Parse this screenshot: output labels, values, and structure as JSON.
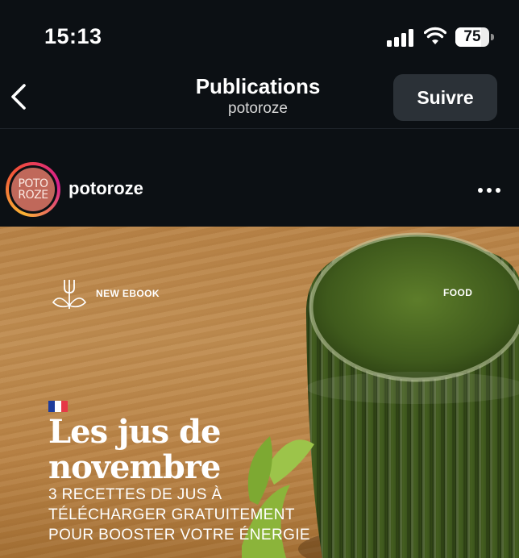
{
  "status_bar": {
    "time": "15:13",
    "battery_percent": "75",
    "battery_level": 0.75
  },
  "header": {
    "title": "Publications",
    "subtitle": "potoroze",
    "follow_label": "Suivre"
  },
  "post": {
    "username": "potoroze",
    "avatar_text": [
      "POTO",
      "ROZE"
    ],
    "image": {
      "ebook_label": "NEW EBOOK",
      "category_label": "FOOD",
      "headline_line1": "Les jus de",
      "headline_line2": "novembre",
      "subhead_line1": "3 RECETTES DE JUS À",
      "subhead_line2": "TÉLÉCHARGER GRATUITEMENT",
      "subhead_line3": "POUR BOOSTER VOTRE ÉNERGIE"
    }
  },
  "icons": {
    "back": "chevron-left-icon",
    "more": "more-horizontal-icon",
    "signal": "cellular-signal-icon",
    "wifi": "wifi-icon",
    "battery": "battery-icon",
    "flag": "french-flag-icon",
    "logo": "fork-leaf-logo-icon"
  },
  "colors": {
    "background": "#0c1014",
    "follow_button": "#2b3137",
    "flag_blue": "#1f3c9a",
    "flag_white": "#ffffff",
    "flag_red": "#e63946"
  }
}
